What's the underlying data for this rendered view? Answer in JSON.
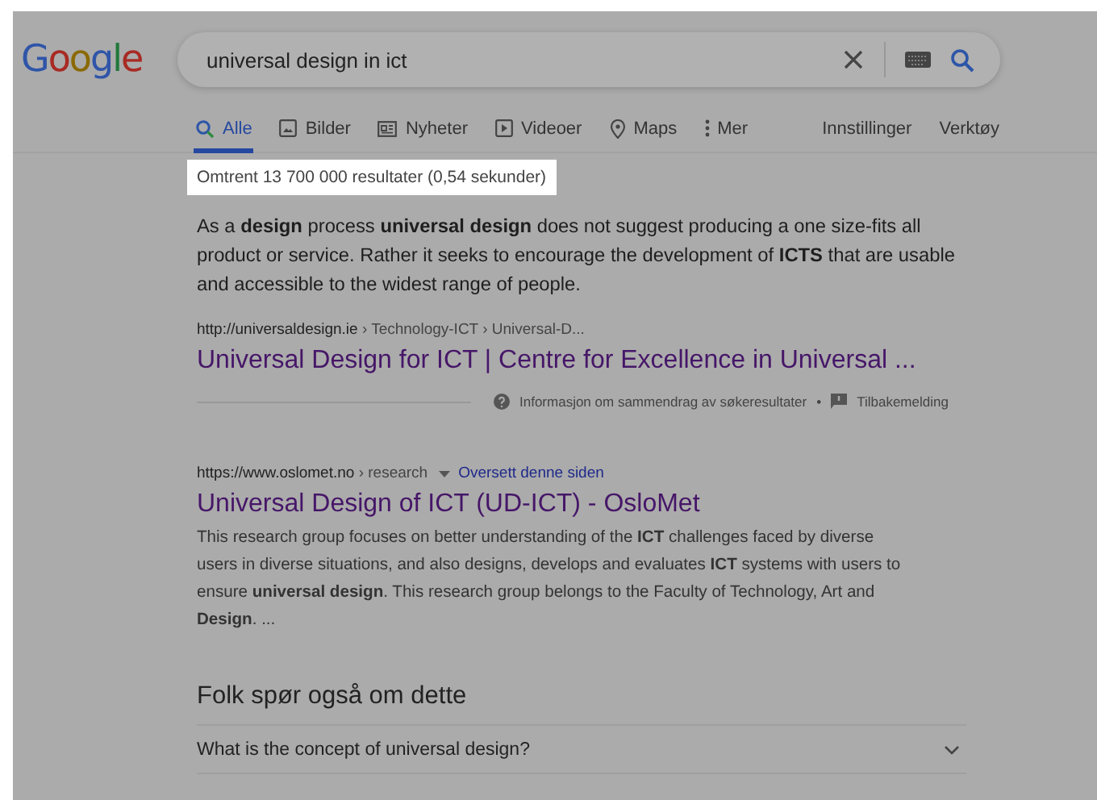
{
  "search": {
    "value": "universal design in ict"
  },
  "logo": "Google",
  "tabs": [
    {
      "label": "Alle",
      "kind": "search",
      "selected": true
    },
    {
      "label": "Bilder",
      "kind": "image",
      "selected": false
    },
    {
      "label": "Nyheter",
      "kind": "news",
      "selected": false
    },
    {
      "label": "Videoer",
      "kind": "video",
      "selected": false
    },
    {
      "label": "Maps",
      "kind": "pin",
      "selected": false
    },
    {
      "label": "Mer",
      "kind": "dots",
      "selected": false
    }
  ],
  "tools": [
    "Innstillinger",
    "Verktøy"
  ],
  "result_stats": "Omtrent 13 700 000 resultater (0,54 sekunder)",
  "featured_snippet": {
    "text": "As a **design** process **universal design** does not suggest producing a one size-fits all product or service. Rather it seeks to encourage the development of **ICTS** that are usable and accessible to the widest range of people.",
    "url": "http://universaldesign.ie",
    "breadcrumb": " › Technology-ICT › Universal-D...",
    "title": "Universal Design for ICT | Centre for Excellence in Universal ...",
    "about": "Informasjon om sammendrag av søkeresultater",
    "separator": "•",
    "feedback": "Tilbakemelding"
  },
  "results": [
    {
      "url": "https://www.oslomet.no",
      "breadcrumb": " › research",
      "translate": "Oversett denne siden",
      "title": "Universal Design of ICT (UD-ICT) - OsloMet",
      "snippet": "This research group focuses on better understanding of the **ICT** challenges faced by diverse users in diverse situations, and also designs, develops and evaluates **ICT** systems with users to ensure **universal design**. This research group belongs to the Faculty of Technology, Art and **Design**. ..."
    }
  ],
  "people_also_ask": {
    "heading": "Folk spør også om dette",
    "questions": [
      "What is the concept of universal design?"
    ]
  }
}
